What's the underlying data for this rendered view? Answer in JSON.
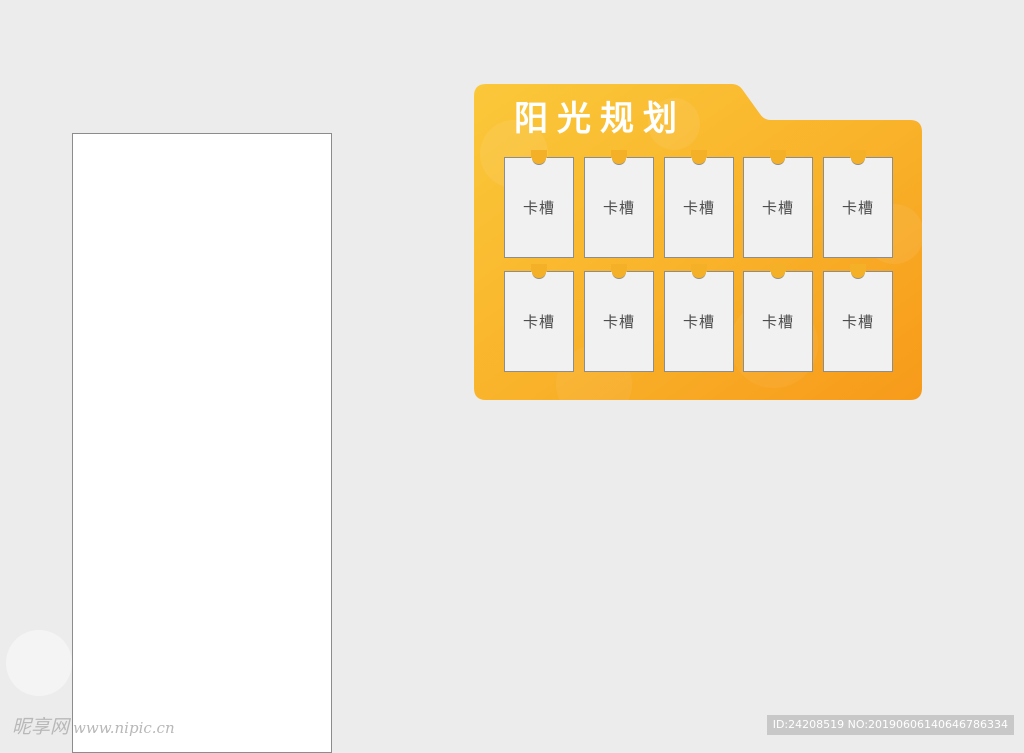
{
  "board": {
    "title": "阳光规划",
    "slot_label": "卡槽",
    "colors": {
      "gradient_start": "#fbc83a",
      "gradient_end": "#f89e1b",
      "slot_fill": "#f1f1f1",
      "title_text": "#ffffff"
    }
  },
  "watermark": {
    "logo_text": "昵享网",
    "site": "www.nipic.cn",
    "id_text": "ID:24208519 NO:20190606140646786334"
  }
}
